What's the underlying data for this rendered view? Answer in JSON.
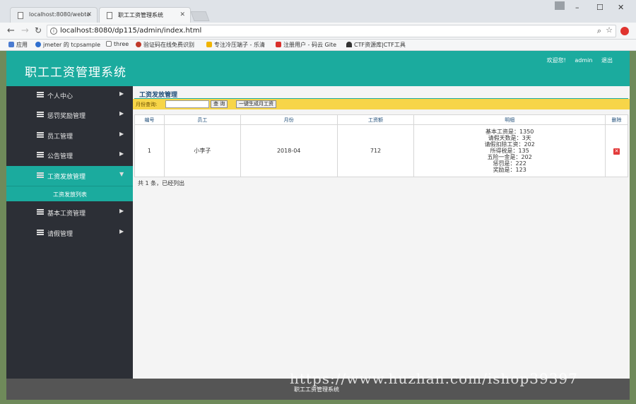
{
  "browser": {
    "tabs": [
      {
        "title": "localhost:8080/webto"
      },
      {
        "title": "职工工资管理系统"
      }
    ],
    "url": "localhost:8080/dp115/admin/index.html",
    "bookmarks": [
      "应用",
      "jmeter 的 tcpsample",
      "three",
      "验证码在线免费识别",
      "专注冷压端子 - 乐清",
      "注册用户 - 码云 Gite",
      "CTF资源库|CTF工具"
    ]
  },
  "header": {
    "title": "职工工资管理系统",
    "welcome": "欢迎您!",
    "user": "admin",
    "logout": "退出"
  },
  "sidebar": {
    "items": [
      {
        "label": "个人中心"
      },
      {
        "label": "惩罚奖励管理"
      },
      {
        "label": "员工管理"
      },
      {
        "label": "公告管理"
      },
      {
        "label": "工资发放管理"
      },
      {
        "label": "基本工资管理"
      },
      {
        "label": "请假管理"
      }
    ],
    "sub_item": "工资发放列表"
  },
  "content": {
    "title": "工资发放管理",
    "search_label": "月份查询:",
    "search_value": "",
    "query_button": "查 询",
    "generate_button": "一键生成月工资",
    "columns": [
      "编号",
      "员工",
      "月份",
      "工资额",
      "明细",
      "删除"
    ],
    "rows": [
      {
        "id": "1",
        "employee": "小李子",
        "month": "2018-04",
        "amount": "712",
        "details": [
          "基本工资是：1350",
          "请假天数是：3天",
          "请假扣除工资：202",
          "所得税是：135",
          "五险一金是：202",
          "惩罚是：222",
          "奖励是：123"
        ]
      }
    ],
    "summary": "共 1 条，已经列出"
  },
  "footer": {
    "text": "职工工资管理系统"
  },
  "watermark": "https://www.huzhan.com/ishop39397"
}
